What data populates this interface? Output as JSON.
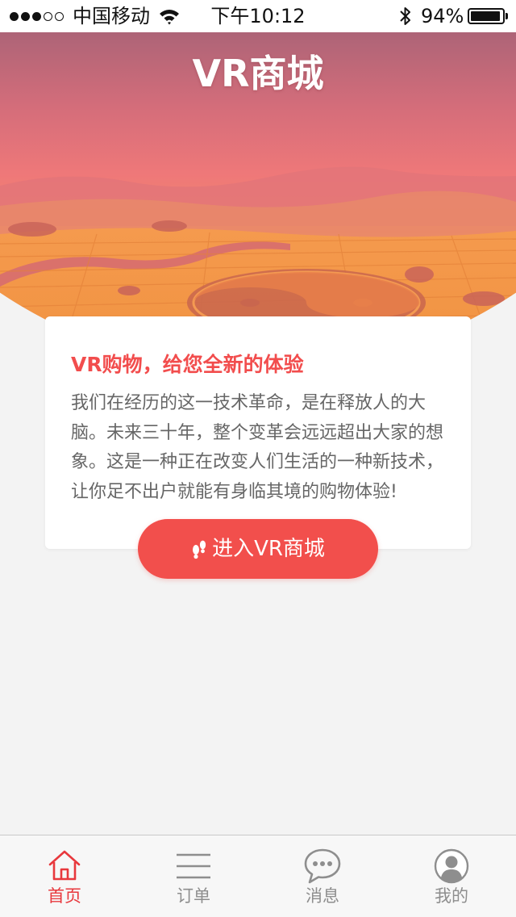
{
  "status_bar": {
    "carrier": "中国移动",
    "time": "下午10:12",
    "battery_percent": "94%",
    "battery_level": 0.94,
    "signal_bars_filled": 3,
    "signal_bars_total": 5
  },
  "header": {
    "title": "VR商城"
  },
  "hero_colors": {
    "overlay_top": "#b06677",
    "overlay_mid": "#ee7077",
    "field": "#f19544"
  },
  "card": {
    "title": "VR购物，给您全新的体验",
    "body": "我们在经历的这一技术革命，是在释放人的大脑。未来三十年，整个变革会远远超出大家的想象。这是一种正在改变人们生活的一种新技术，让你足不出户就能有身临其境的购物体验!"
  },
  "cta": {
    "label": "进入VR商城",
    "icon": "footprints-icon",
    "color": "#f24f4c"
  },
  "tab_bar": {
    "active_color": "#e8383d",
    "inactive_color": "#8e8e8e",
    "items": [
      {
        "label": "首页",
        "icon": "home-icon",
        "active": true
      },
      {
        "label": "订单",
        "icon": "list-icon",
        "active": false
      },
      {
        "label": "消息",
        "icon": "chat-icon",
        "active": false
      },
      {
        "label": "我的",
        "icon": "user-icon",
        "active": false
      }
    ]
  }
}
